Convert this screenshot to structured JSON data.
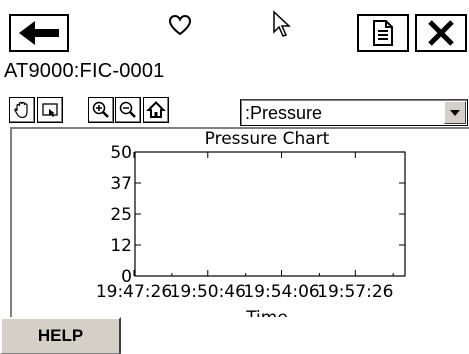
{
  "tag": {
    "title": "AT9000:FIC-0001"
  },
  "toolbar": {
    "tools": [
      "pan-icon",
      "zoom-box-icon",
      "zoom-in-icon",
      "zoom-out-icon",
      "home-icon"
    ],
    "series_select": {
      "value": ":Pressure"
    }
  },
  "chart_data": {
    "type": "line",
    "title": "Pressure Chart",
    "xlabel": "Time",
    "ylabel": "",
    "x_ticks": [
      "19:47:26",
      "19:50:46",
      "19:54:06",
      "19:57:26"
    ],
    "y_ticks": [
      "0",
      "12",
      "25",
      "37",
      "50"
    ],
    "ylim": [
      0,
      50
    ],
    "grid": false,
    "series": []
  },
  "footer": {
    "help_label": "HELP"
  },
  "colors": {
    "frame": "#808080",
    "button_face": "#d4d0c8"
  }
}
